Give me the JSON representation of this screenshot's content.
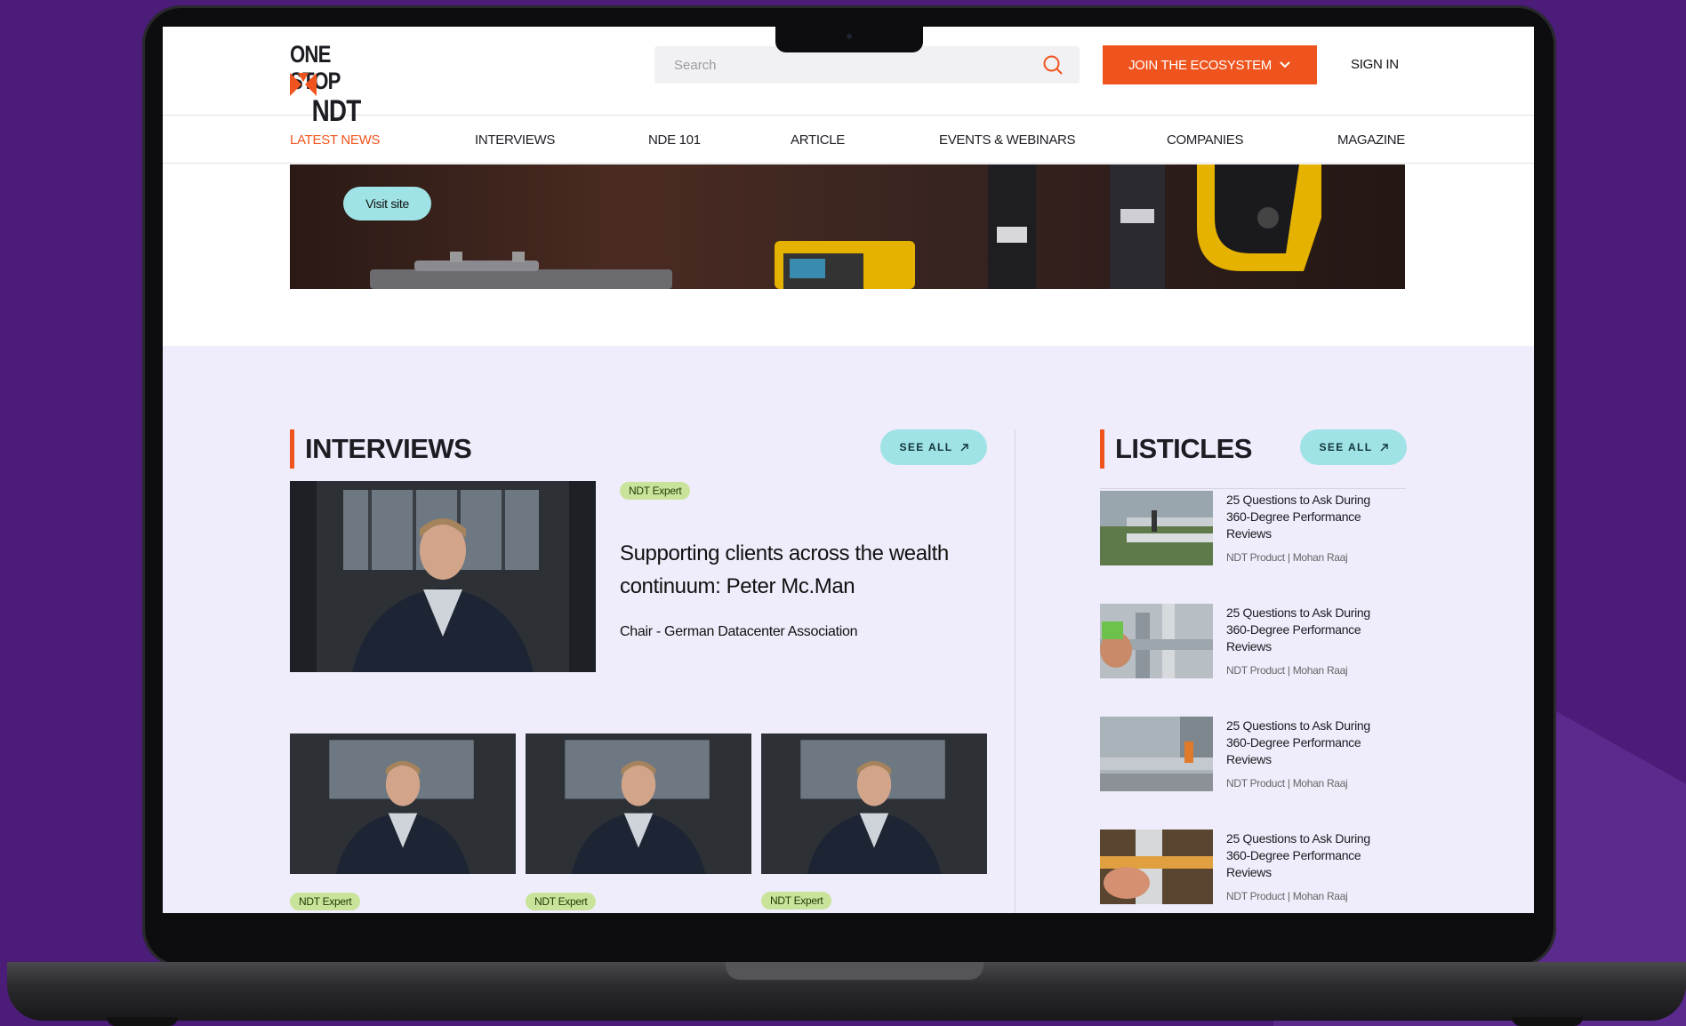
{
  "logo": {
    "line1": "ONE STOP",
    "line2": "NDT"
  },
  "search": {
    "placeholder": "Search"
  },
  "header": {
    "join_label": "JOIN THE ECOSYSTEM",
    "signin_label": "SIGN IN"
  },
  "nav": {
    "items": [
      {
        "label": "LATEST NEWS",
        "active": true
      },
      {
        "label": "INTERVIEWS"
      },
      {
        "label": "NDE 101"
      },
      {
        "label": "ARTICLE"
      },
      {
        "label": "EVENTS & WEBINARS"
      },
      {
        "label": "COMPANIES"
      },
      {
        "label": "MAGAZINE"
      }
    ]
  },
  "banner": {
    "visit_label": "Visit site"
  },
  "interviews": {
    "title": "INTERVIEWS",
    "see_all": "SEE ALL",
    "featured": {
      "badge": "NDT Expert",
      "title": "Supporting clients across the wealth continuum: Peter Mc.Man",
      "subtitle": "Chair - German Datacenter Association"
    },
    "cards": [
      {
        "badge": "NDT Expert"
      },
      {
        "badge": "NDT Expert"
      },
      {
        "badge": "NDT Expert"
      }
    ]
  },
  "listicles": {
    "title": "LISTICLES",
    "see_all": "SEE ALL",
    "items": [
      {
        "title": "25 Questions to Ask During 360-Degree Performance Reviews",
        "meta": "NDT Product | Mohan Raaj"
      },
      {
        "title": "25 Questions to Ask During 360-Degree Performance Reviews",
        "meta": "NDT Product | Mohan Raaj"
      },
      {
        "title": "25 Questions to Ask During 360-Degree Performance Reviews",
        "meta": "NDT Product | Mohan Raaj"
      },
      {
        "title": "25 Questions to Ask During 360-Degree Performance Reviews",
        "meta": "NDT Product | Mohan Raaj"
      }
    ]
  },
  "colors": {
    "accent": "#f0541e",
    "pill": "#9fe3e6",
    "badge": "#c9e49a",
    "section_bg": "#efedfb",
    "backdrop": "#4b1d78"
  }
}
